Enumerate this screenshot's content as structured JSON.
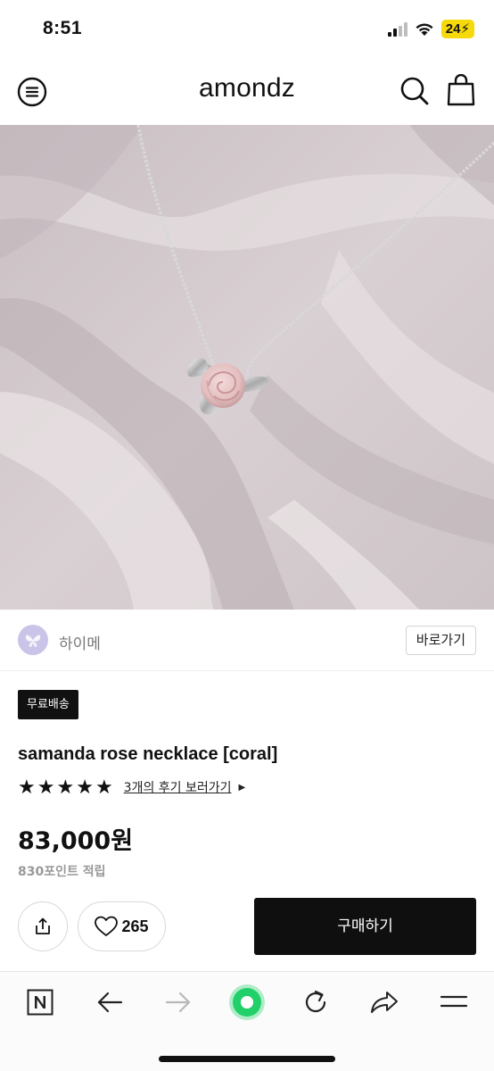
{
  "status_bar": {
    "time": "8:51",
    "battery": "24",
    "icons": [
      "cellular-signal-icon",
      "wifi-icon",
      "battery-charging-icon"
    ]
  },
  "header": {
    "logo": "amondz",
    "icons": [
      "menu-icon",
      "search-icon",
      "shopping-bag-icon"
    ]
  },
  "seller": {
    "name": "하이메",
    "goto_label": "바로가기"
  },
  "product": {
    "badge": "무료배송",
    "title": "samanda rose necklace [coral]",
    "rating_stars": 5,
    "review_link": "3개의 후기 보러가기",
    "price": "83,000원",
    "points": "830포인트 적립",
    "like_count": "265"
  },
  "actions": {
    "buy_label": "구매하기"
  },
  "browser_bar": {
    "icons": [
      "naver-n-icon",
      "back-arrow-icon",
      "forward-arrow-icon",
      "green-circle-icon",
      "reload-icon",
      "share-arrow-icon",
      "menu-lines-icon"
    ]
  },
  "colors": {
    "accent_black": "#0f0f0f",
    "badge_bg": "#111111",
    "battery_yellow": "#f5d90a",
    "browser_green": "#22d06a",
    "points_gray": "#999999"
  }
}
